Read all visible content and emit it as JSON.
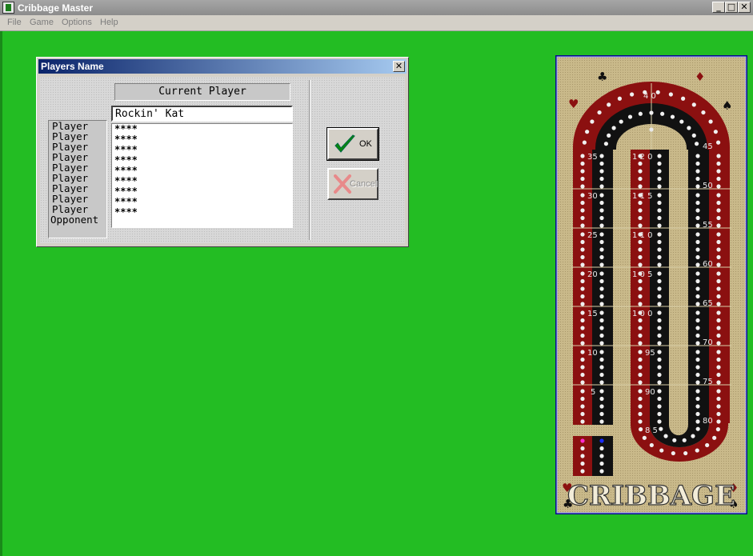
{
  "window": {
    "title": "Cribbage Master",
    "controls": {
      "minimize": "_",
      "maximize": "□",
      "close": "✕"
    }
  },
  "menubar": {
    "items": [
      "File",
      "Game",
      "Options",
      "Help"
    ]
  },
  "dialog": {
    "title": "Players Name",
    "close_label": "✕",
    "current_player_label": "Current Player",
    "name_value": "Rockin' Kat",
    "player_labels": [
      "Player",
      "Player",
      "Player",
      "Player",
      "Player",
      "Player",
      "Player",
      "Player",
      "Player",
      "Opponent"
    ],
    "saved_names": [
      "****",
      "****",
      "****",
      "****",
      "****",
      "****",
      "****",
      "****",
      "****"
    ],
    "ok_label": "OK",
    "cancel_label": "Cancel",
    "ok_icon": "check-icon",
    "cancel_icon": "x-icon"
  },
  "board": {
    "title": "CRIBBAGE",
    "colors": {
      "felt": "#c9b98a",
      "red": "#8b1010",
      "black": "#111111",
      "frame": "#0a0a8a",
      "table": "#23bd23"
    },
    "left_labels": [
      "35",
      "30",
      "25",
      "20",
      "15",
      "10",
      "5"
    ],
    "center_labels": [
      "1 2 0",
      "1 1 5",
      "1 1 0",
      "1 0 5",
      "1 0 0",
      "95",
      "90"
    ],
    "right_labels": [
      "45",
      "50",
      "55",
      "60",
      "65",
      "70",
      "75",
      "80"
    ],
    "top_label": "4 0",
    "bottom_label": "8 5",
    "suits": {
      "spade": "♠",
      "heart": "♥",
      "diamond": "♦",
      "club": "♣"
    },
    "pegs": {
      "player1": "#ff2bd2",
      "player2": "#1a2bff"
    }
  }
}
